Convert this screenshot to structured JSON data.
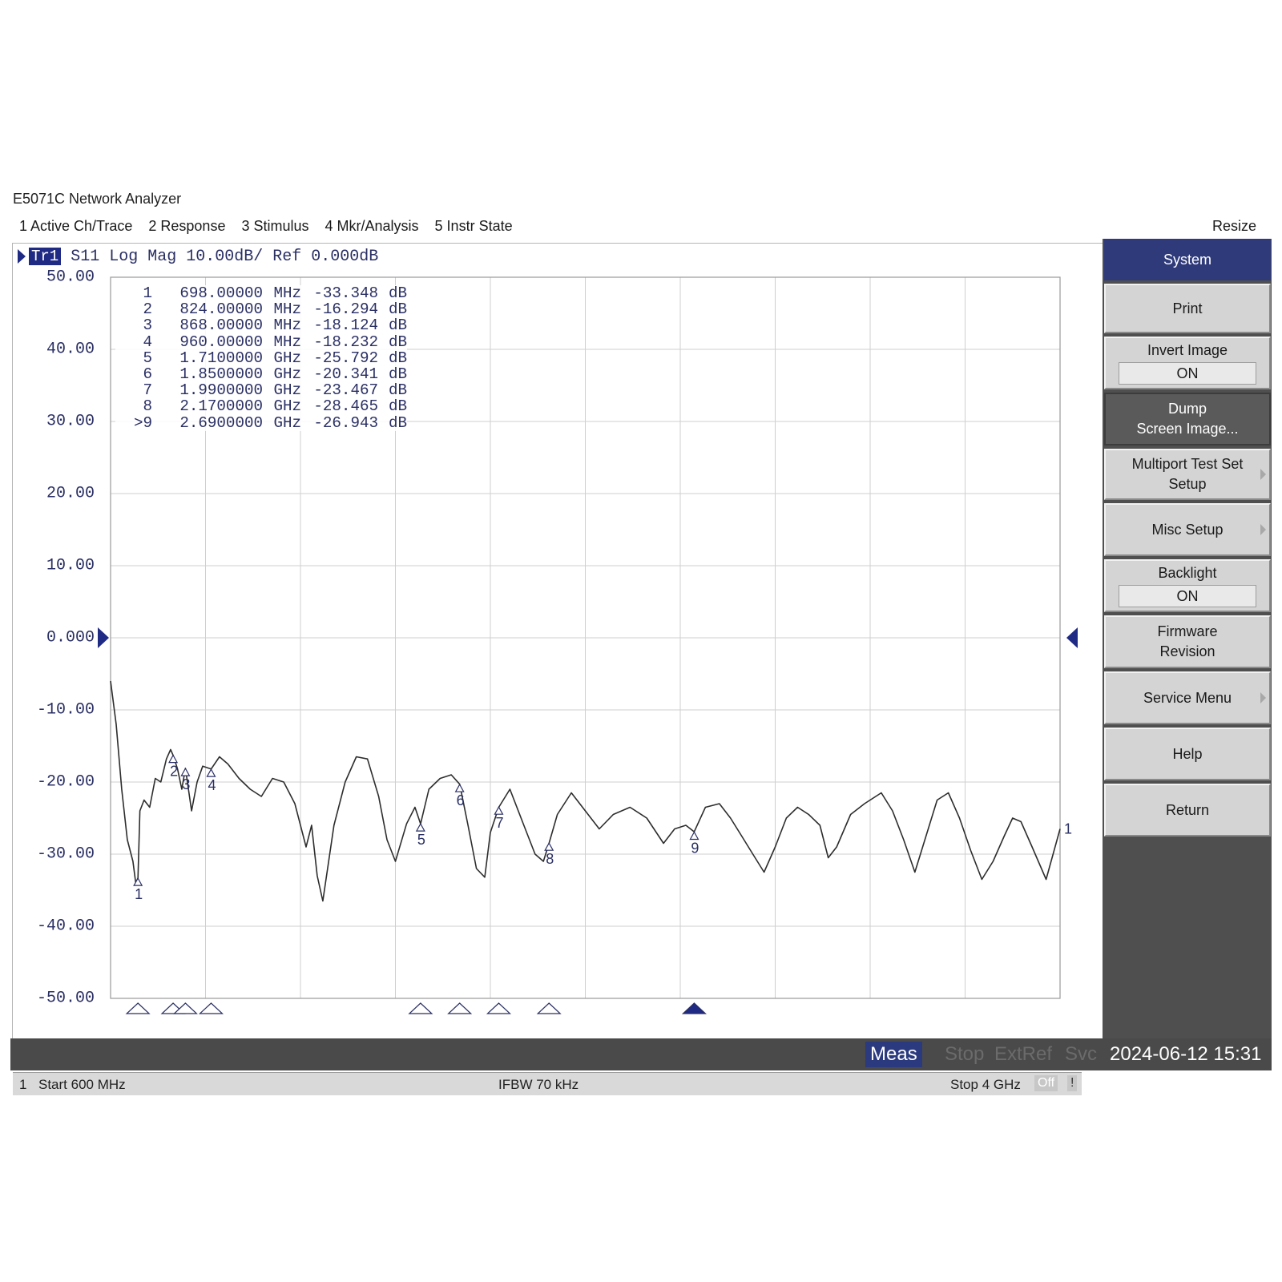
{
  "window": {
    "title": "E5071C Network Analyzer"
  },
  "menu": {
    "items": [
      "1 Active Ch/Trace",
      "2 Response",
      "3 Stimulus",
      "4 Mkr/Analysis",
      "5 Instr State"
    ],
    "resize_label": "Resize"
  },
  "trace": {
    "badge": "Tr1",
    "label": "S11 Log Mag 10.00dB/ Ref 0.000dB"
  },
  "y_axis": {
    "ticks": [
      "50.00",
      "40.00",
      "30.00",
      "20.00",
      "10.00",
      "0.000",
      "-10.00",
      "-20.00",
      "-30.00",
      "-40.00",
      "-50.00"
    ]
  },
  "markers": [
    {
      "num": "1",
      "freq": "698.00000",
      "unit": "MHz",
      "value": "-33.348",
      "db": "dB"
    },
    {
      "num": "2",
      "freq": "824.00000",
      "unit": "MHz",
      "value": "-16.294",
      "db": "dB"
    },
    {
      "num": "3",
      "freq": "868.00000",
      "unit": "MHz",
      "value": "-18.124",
      "db": "dB"
    },
    {
      "num": "4",
      "freq": "960.00000",
      "unit": "MHz",
      "value": "-18.232",
      "db": "dB"
    },
    {
      "num": "5",
      "freq": "1.7100000",
      "unit": "GHz",
      "value": "-25.792",
      "db": "dB"
    },
    {
      "num": "6",
      "freq": "1.8500000",
      "unit": "GHz",
      "value": "-20.341",
      "db": "dB"
    },
    {
      "num": "7",
      "freq": "1.9900000",
      "unit": "GHz",
      "value": "-23.467",
      "db": "dB"
    },
    {
      "num": "8",
      "freq": "2.1700000",
      "unit": "GHz",
      "value": "-28.465",
      "db": "dB"
    },
    {
      "num": ">9",
      "freq": "2.6900000",
      "unit": "GHz",
      "value": "-26.943",
      "db": "dB"
    }
  ],
  "status": {
    "channel": "1",
    "start": "Start 600 MHz",
    "ifbw": "IFBW 70 kHz",
    "stop": "Stop 4 GHz",
    "off_badge": "Off",
    "warn_badge": "!"
  },
  "bottom_bar": {
    "meas": "Meas",
    "stop": "Stop",
    "extref": "ExtRef",
    "svc": "Svc",
    "datetime": "2024-06-12 15:31"
  },
  "softkeys": {
    "system": "System",
    "print": "Print",
    "invert_image": {
      "label": "Invert Image",
      "value": "ON"
    },
    "dump_line1": "Dump",
    "dump_line2": "Screen Image...",
    "multiport_line1": "Multiport Test Set",
    "multiport_line2": "Setup",
    "misc_setup": "Misc Setup",
    "backlight": {
      "label": "Backlight",
      "value": "ON"
    },
    "firmware_line1": "Firmware",
    "firmware_line2": "Revision",
    "service_menu": "Service Menu",
    "help": "Help",
    "return": "Return"
  },
  "chart_data": {
    "type": "line",
    "title": "S11 Log Mag 10.00dB/ Ref 0.000dB",
    "xlabel": "",
    "ylabel": "",
    "x_unit": "GHz",
    "xlim": [
      0.6,
      4.0
    ],
    "ylim": [
      -50,
      50
    ],
    "reference_level": 0,
    "grid": true,
    "series": [
      {
        "x": [
          0.6,
          0.62,
          0.64,
          0.66,
          0.68,
          0.69,
          0.698,
          0.705,
          0.72,
          0.74,
          0.76,
          0.78,
          0.8,
          0.815,
          0.824,
          0.84,
          0.855,
          0.868,
          0.89,
          0.91,
          0.93,
          0.96,
          0.99,
          1.02,
          1.06,
          1.1,
          1.14,
          1.18,
          1.22,
          1.26,
          1.3,
          1.32,
          1.34,
          1.36,
          1.4,
          1.44,
          1.48,
          1.52,
          1.56,
          1.59,
          1.62,
          1.66,
          1.69,
          1.71,
          1.74,
          1.78,
          1.82,
          1.85,
          1.88,
          1.91,
          1.94,
          1.96,
          1.99,
          2.03,
          2.08,
          2.12,
          2.15,
          2.17,
          2.2,
          2.25,
          2.3,
          2.35,
          2.4,
          2.46,
          2.52,
          2.58,
          2.62,
          2.66,
          2.69,
          2.73,
          2.78,
          2.82,
          2.86,
          2.9,
          2.94,
          2.98,
          3.02,
          3.06,
          3.1,
          3.14,
          3.17,
          3.2,
          3.25,
          3.3,
          3.36,
          3.4,
          3.44,
          3.48,
          3.52,
          3.56,
          3.6,
          3.64,
          3.68,
          3.72,
          3.76,
          3.8,
          3.83,
          3.86,
          3.9,
          3.95,
          4.0
        ],
        "y": [
          -6,
          -12,
          -21,
          -28,
          -31,
          -34,
          -33.3,
          -24,
          -22.5,
          -23.5,
          -19.5,
          -20,
          -16.8,
          -15.5,
          -16.3,
          -18.2,
          -21,
          -18.1,
          -24,
          -20,
          -17.8,
          -18.2,
          -16.5,
          -17.5,
          -19.5,
          -21,
          -22,
          -19.5,
          -20,
          -23,
          -29,
          -26,
          -33,
          -36.5,
          -26,
          -20,
          -16.5,
          -16.8,
          -22,
          -28,
          -31,
          -25.8,
          -23.5,
          -25.8,
          -21,
          -19.5,
          -19,
          -20.3,
          -26,
          -32,
          -33.2,
          -27,
          -23.5,
          -21,
          -26,
          -30,
          -31,
          -28.5,
          -24.5,
          -21.5,
          -24,
          -26.5,
          -24.5,
          -23.5,
          -25,
          -28.5,
          -26.5,
          -26,
          -26.9,
          -23.5,
          -23,
          -25,
          -27.5,
          -30,
          -32.5,
          -29,
          -25,
          -23.5,
          -24.5,
          -26,
          -30.5,
          -29,
          -24.5,
          -23,
          -21.5,
          -24,
          -28,
          -32.5,
          -27.5,
          -22.5,
          -21.5,
          -25,
          -29.5,
          -33.5,
          -31,
          -27.5,
          -25,
          -25.5,
          -29,
          -33.5,
          -26.5
        ]
      }
    ],
    "marker_points": [
      {
        "label": "1",
        "x": 0.698,
        "y": -33.348
      },
      {
        "label": "2",
        "x": 0.824,
        "y": -16.294
      },
      {
        "label": "3",
        "x": 0.868,
        "y": -18.124
      },
      {
        "label": "4",
        "x": 0.96,
        "y": -18.232
      },
      {
        "label": "5",
        "x": 1.71,
        "y": -25.792
      },
      {
        "label": "6",
        "x": 1.85,
        "y": -20.341
      },
      {
        "label": "7",
        "x": 1.99,
        "y": -23.467
      },
      {
        "label": "8",
        "x": 2.17,
        "y": -28.465
      },
      {
        "label": "9",
        "x": 2.69,
        "y": -26.943
      }
    ],
    "active_marker": "9"
  }
}
